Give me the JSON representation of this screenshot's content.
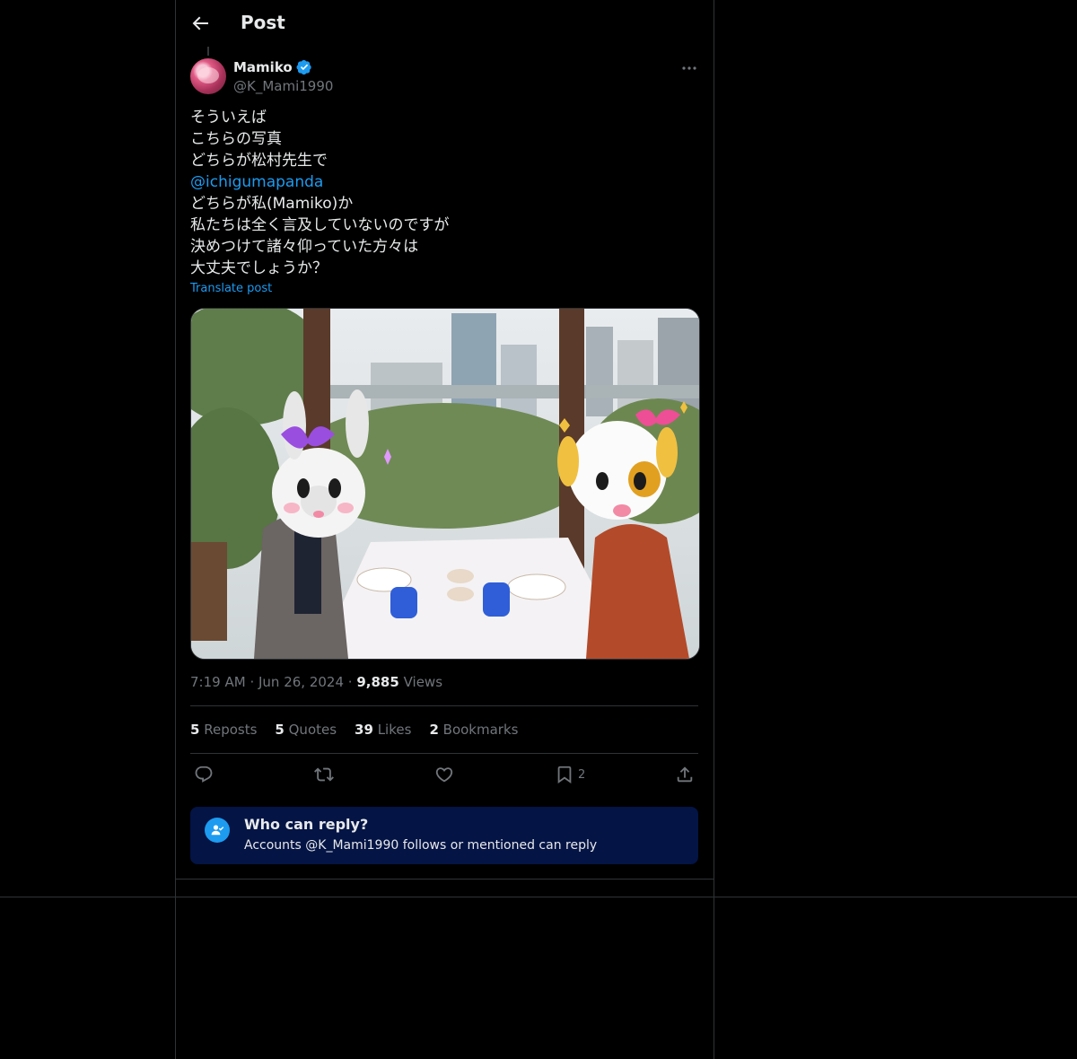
{
  "header": {
    "title": "Post",
    "back_icon": "arrow-left-icon"
  },
  "post": {
    "author_name": "Mamiko",
    "author_handle": "@K_Mami1990",
    "verified": true,
    "text_lines": [
      "そういえば",
      "こちらの写真",
      "どちらが松村先生で",
      "@ichigumapanda",
      "どちらが私(Mamiko)か",
      "私たちは全く言及していないのですが",
      "決めつけて諸々仰っていた方々は",
      "大丈夫でしょうか？"
    ],
    "translate_label": "Translate post",
    "time": "7:19 AM",
    "date": "Jun 26, 2024",
    "views_count": "9,885",
    "views_label": "Views",
    "separator": "·"
  },
  "stats": {
    "reposts_count": "5",
    "reposts_label": "Reposts",
    "quotes_count": "5",
    "quotes_label": "Quotes",
    "likes_count": "39",
    "likes_label": "Likes",
    "bookmarks_count": "2",
    "bookmarks_label": "Bookmarks"
  },
  "actions": {
    "reply_icon": "reply-icon",
    "repost_icon": "repost-icon",
    "like_icon": "heart-icon",
    "bookmark_icon": "bookmark-icon",
    "bookmark_count": "2",
    "share_icon": "share-icon"
  },
  "reply_settings": {
    "title": "Who can reply?",
    "subtitle": "Accounts @K_Mami1990 follows or mentioned can reply"
  },
  "colors": {
    "accent": "#1d9bf0",
    "background": "#000000",
    "border": "#2f3336",
    "muted": "#71767b",
    "reply_box": "#031445"
  }
}
